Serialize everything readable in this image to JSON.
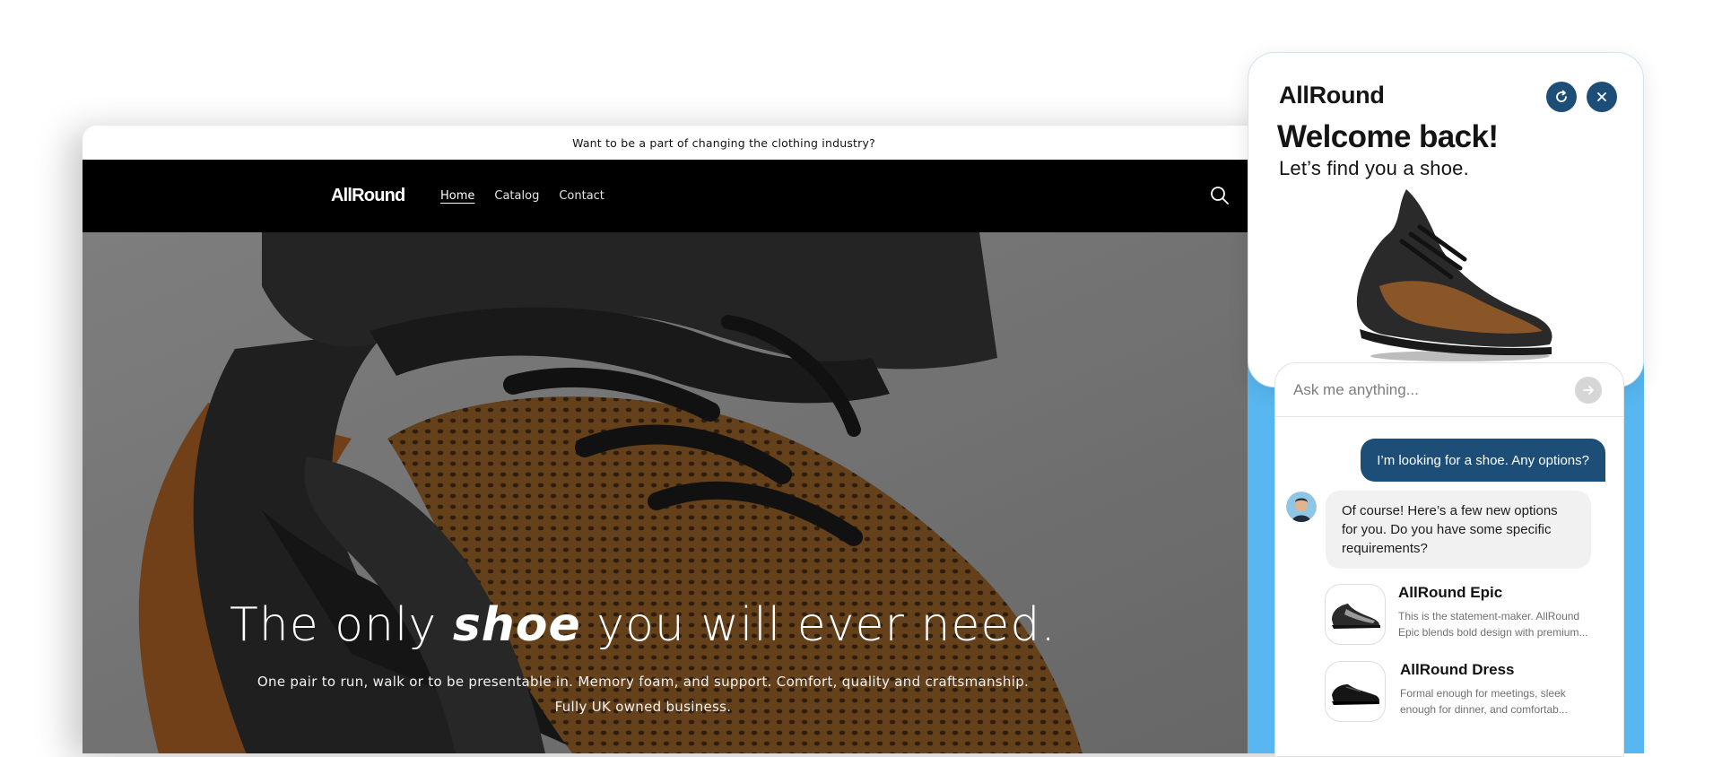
{
  "announcement": {
    "text": "Want to be a part of changing the clothing industry?"
  },
  "header": {
    "logo": "AllRound",
    "nav": [
      {
        "label": "Home",
        "active": true
      },
      {
        "label": "Catalog",
        "active": false
      },
      {
        "label": "Contact",
        "active": false
      }
    ],
    "search_icon": "search-icon"
  },
  "hero": {
    "title_pre": "The only ",
    "title_emph": "shoe",
    "title_post": " you will ever need.",
    "sub_line1": "One pair to run, walk or to be presentable in. Memory foam, and support. Comfort, quality and craftsmanship.",
    "sub_line2": "Fully UK owned business."
  },
  "chat": {
    "brand": "AllRound",
    "welcome": "Welcome back!",
    "subhead": "Let’s find you a shoe.",
    "input_placeholder": "Ask me anything...",
    "user_message": "I’m looking for a shoe. Any options?",
    "bot_message": "Of course! Here’s a few new options for you. Do you have some specific requirements?",
    "products": [
      {
        "name": "AllRound Epic",
        "desc": "This is the statement-maker. AllRound Epic blends bold design with premium..."
      },
      {
        "name": "AllRound Dress",
        "desc": "Formal enough for meetings, sleek enough for dinner, and comfortab..."
      }
    ],
    "colors": {
      "accent": "#1c4e77",
      "panel_blue": "#58b7f0"
    }
  }
}
